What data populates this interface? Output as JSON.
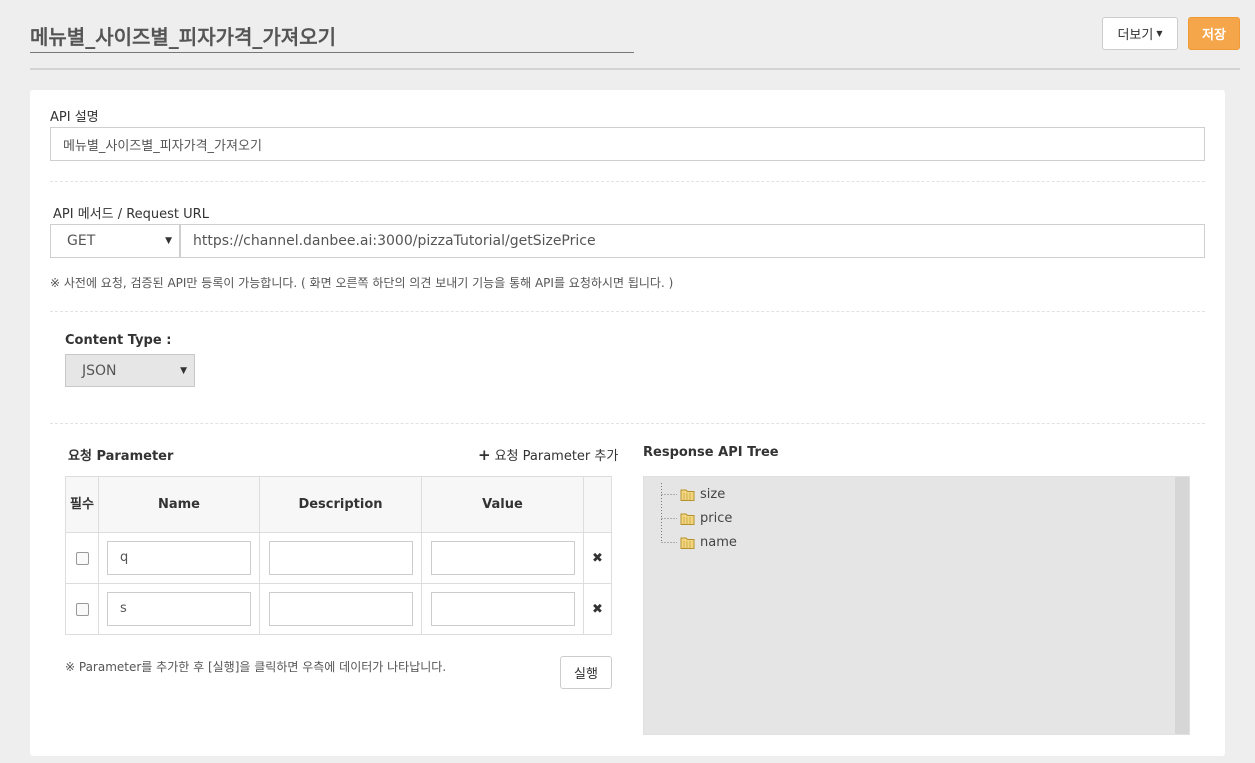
{
  "header": {
    "title": "메뉴별_사이즈별_피자가격_가져오기",
    "more_label": "더보기",
    "save_label": "저장"
  },
  "api_description": {
    "label": "API 설명",
    "value": "메뉴별_사이즈별_피자가격_가져오기"
  },
  "request": {
    "label": "API 메서드 / Request URL",
    "method": "GET",
    "url": "https://channel.danbee.ai:3000/pizzaTutorial/getSizePrice",
    "notice": "※ 사전에 요청, 검증된 API만 등록이 가능합니다. ( 화면 오른쪽 하단의 의견 보내기 기능을 통해 API를 요청하시면 됩니다. )"
  },
  "content_type": {
    "label": "Content Type :",
    "value": "JSON"
  },
  "params": {
    "title": "요청 Parameter",
    "add_label": "요청 Parameter 추가",
    "columns": {
      "required": "필수",
      "name": "Name",
      "description": "Description",
      "value": "Value"
    },
    "rows": [
      {
        "name": "q",
        "description": "",
        "value": ""
      },
      {
        "name": "s",
        "description": "",
        "value": ""
      }
    ],
    "notice": "※ Parameter를 추가한 후 [실행]을 클릭하면 우측에 데이터가 나타납니다.",
    "run_label": "실행"
  },
  "response_tree": {
    "title": "Response API Tree",
    "nodes": [
      "size",
      "price",
      "name"
    ]
  },
  "colors": {
    "save_button": "#f5a54a",
    "tree_background": "#e5e5e6"
  }
}
